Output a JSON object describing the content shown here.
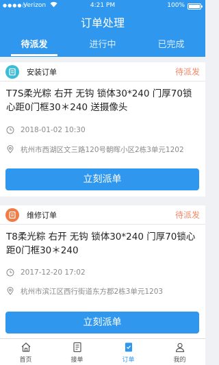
{
  "status_bar": {
    "signal": "●●●●○",
    "carrier": "Verizon",
    "time": "4:21 PM",
    "battery": "100%"
  },
  "header": {
    "title": "订单处理"
  },
  "tabs": [
    {
      "label": "待派发",
      "active": true
    },
    {
      "label": "进行中",
      "active": false
    },
    {
      "label": "已完成",
      "active": false
    }
  ],
  "orders": [
    {
      "type": "安装订单",
      "status": "待派发",
      "icon": "install-icon",
      "description": "T7S柔光粽 右开 无钩 锁体30*240 门厚70锁心距0门框30＊240 送摄像头",
      "datetime": "2018-01-02 10:30",
      "address": "杭州市西湖区文三路120号朝晖小区2栋3单元1202",
      "button": "立刻派单"
    },
    {
      "type": "维修订单",
      "status": "待派发",
      "icon": "repair-icon",
      "description": "T8柔光粽 右开 无钩 锁体30*240 门厚70锁心距0门框30＊240",
      "datetime": "2017-12-20 17:02",
      "address": "杭州市滨江区西行街道东方郡2栋3单元1203",
      "button": "立刻派单"
    }
  ],
  "tabbar": [
    {
      "label": "首页",
      "icon": "home-icon",
      "active": false
    },
    {
      "label": "接单",
      "icon": "receive-order-icon",
      "active": false
    },
    {
      "label": "订单",
      "icon": "order-icon",
      "active": true
    },
    {
      "label": "我的",
      "icon": "profile-icon",
      "active": false
    }
  ],
  "colors": {
    "primary": "#2f97ee",
    "status": "#f28868",
    "teal_badge": "#3bbdd8",
    "orange_badge": "#f07b45"
  }
}
